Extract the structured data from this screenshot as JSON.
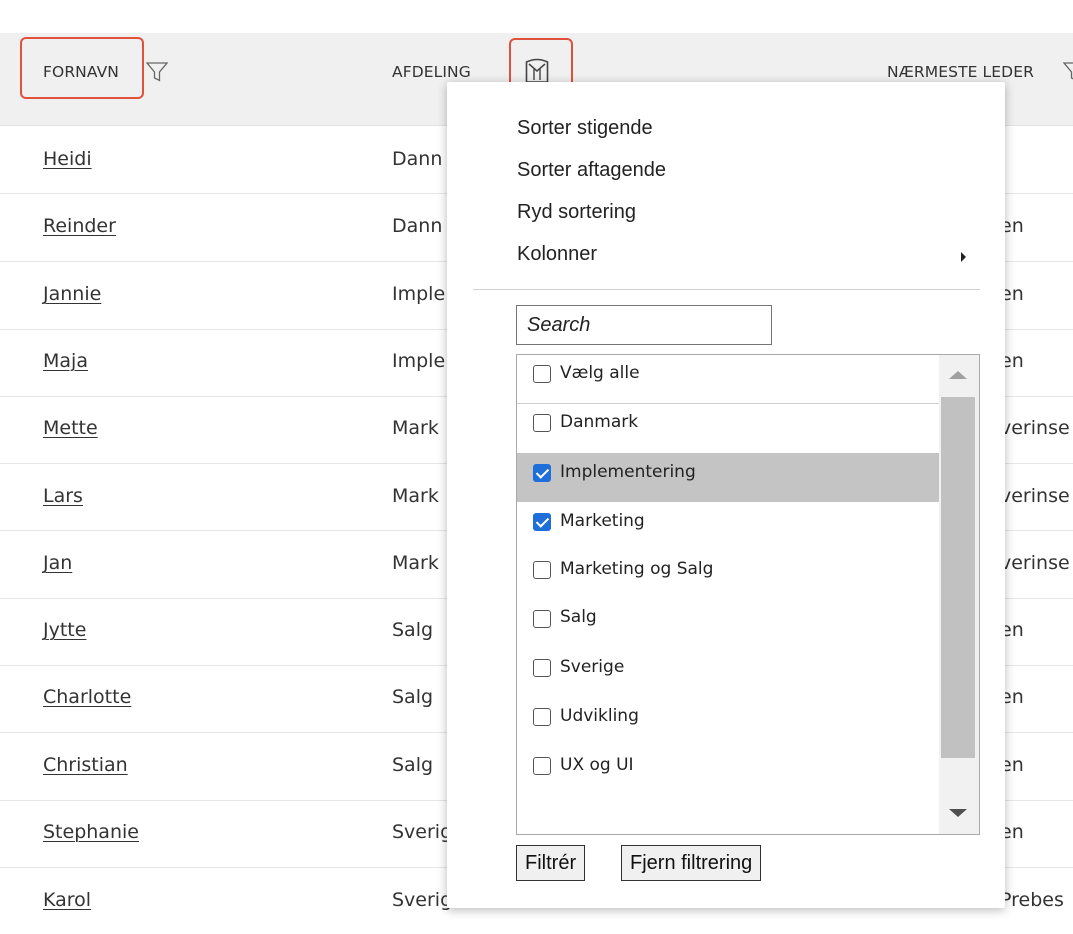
{
  "columns": {
    "first_name": "FORNAVN",
    "department": "AFDELING",
    "manager": "NÆRMESTE LEDER"
  },
  "rows": [
    {
      "name": "Heidi",
      "dept": "Dann",
      "lead": ""
    },
    {
      "name": "Reinder",
      "dept": "Dann",
      "lead": "en"
    },
    {
      "name": "Jannie",
      "dept": "Imple",
      "lead": "en"
    },
    {
      "name": "Maja",
      "dept": "Imple",
      "lead": "en"
    },
    {
      "name": "Mette",
      "dept": "Mark",
      "lead": "verinse"
    },
    {
      "name": "Lars",
      "dept": "Mark",
      "lead": "verinse"
    },
    {
      "name": "Jan",
      "dept": "Mark",
      "lead": "verinse"
    },
    {
      "name": "Jytte",
      "dept": "Salg",
      "lead": "en"
    },
    {
      "name": "Charlotte",
      "dept": "Salg",
      "lead": "en"
    },
    {
      "name": "Christian",
      "dept": "Salg",
      "lead": "en"
    },
    {
      "name": "Stephanie",
      "dept": "Sverig",
      "lead": "en"
    },
    {
      "name": "Karol",
      "dept": "Sverig",
      "lead": "Prebes"
    }
  ],
  "menu": {
    "sort_asc": "Sorter stigende",
    "sort_desc": "Sorter aftagende",
    "clear_sort": "Ryd sortering",
    "columns": "Kolonner",
    "search_placeholder": "Search",
    "select_all": "Vælg alle",
    "options": [
      {
        "label": "Danmark",
        "checked": false
      },
      {
        "label": "Implementering",
        "checked": true
      },
      {
        "label": "Marketing",
        "checked": true
      },
      {
        "label": "Marketing og Salg",
        "checked": false
      },
      {
        "label": "Salg",
        "checked": false
      },
      {
        "label": "Sverige",
        "checked": false
      },
      {
        "label": "Udvikling",
        "checked": false
      },
      {
        "label": "UX og UI",
        "checked": false
      }
    ],
    "filter_button": "Filtrér",
    "clear_filter_button": "Fjern filtrering"
  },
  "colors": {
    "highlight": "#e0523c",
    "checkbox_checked": "#1e6fd9",
    "header_bg": "#f0f0f1"
  }
}
